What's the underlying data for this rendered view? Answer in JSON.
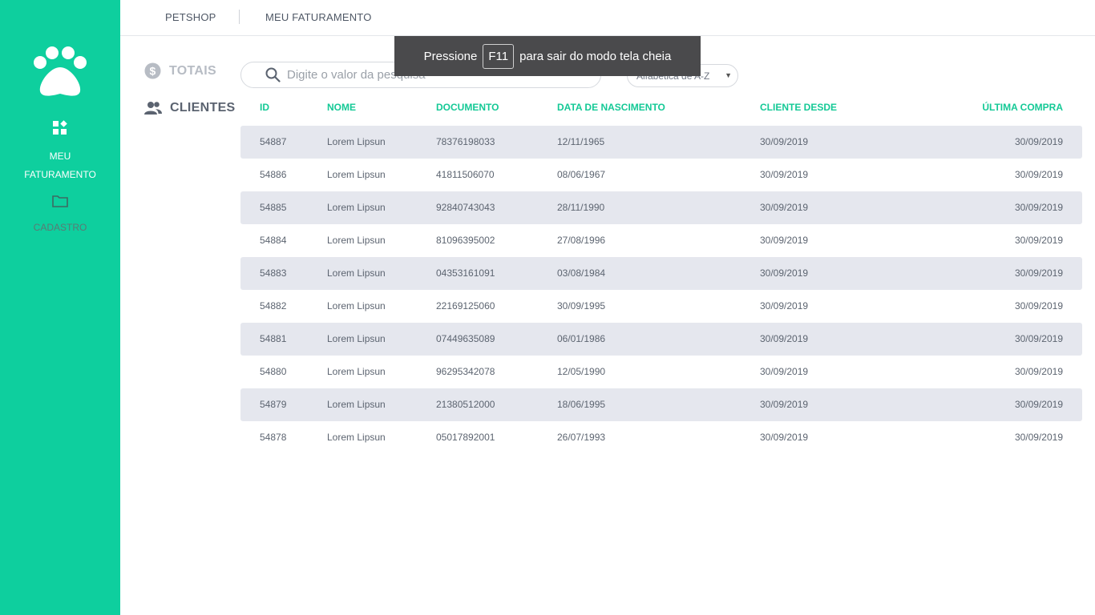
{
  "sidebar": {
    "items": [
      {
        "label_line1": "MEU",
        "label_line2": "FATURAMENTO",
        "icon": "dashboard-icon"
      },
      {
        "label": "CADASTRO",
        "icon": "folder-icon"
      }
    ],
    "logo_icon": "paw-icon",
    "color": "#0ecf9e"
  },
  "topnav": {
    "petshop": "PETSHOP",
    "faturamento": "MEU FATURAMENTO"
  },
  "submenu": {
    "totais": "TOTAIS",
    "clientes": "CLIENTES"
  },
  "search": {
    "placeholder": "Digite o valor da pesquisa"
  },
  "sort": {
    "selected": "Alfabetica de A-Z"
  },
  "toast": {
    "before": "Pressione",
    "key": "F11",
    "after": "para sair do modo tela cheia"
  },
  "table": {
    "headers": {
      "id": "ID",
      "nome": "NOME",
      "documento": "DOCUMENTO",
      "nascimento": "DATA DE NASCIMENTO",
      "desde": "CLIENTE DESDE",
      "ultima": "ÚLTIMA COMPRA"
    },
    "rows": [
      {
        "id": "54887",
        "nome": "Lorem Lipsun",
        "documento": "78376198033",
        "nascimento": "12/11/1965",
        "desde": "30/09/2019",
        "ultima": "30/09/2019"
      },
      {
        "id": "54886",
        "nome": "Lorem Lipsun",
        "documento": "41811506070",
        "nascimento": "08/06/1967",
        "desde": "30/09/2019",
        "ultima": "30/09/2019"
      },
      {
        "id": "54885",
        "nome": "Lorem Lipsun",
        "documento": "92840743043",
        "nascimento": "28/11/1990",
        "desde": "30/09/2019",
        "ultima": "30/09/2019"
      },
      {
        "id": "54884",
        "nome": "Lorem Lipsun",
        "documento": "81096395002",
        "nascimento": "27/08/1996",
        "desde": "30/09/2019",
        "ultima": "30/09/2019"
      },
      {
        "id": "54883",
        "nome": "Lorem Lipsun",
        "documento": "04353161091",
        "nascimento": "03/08/1984",
        "desde": "30/09/2019",
        "ultima": "30/09/2019"
      },
      {
        "id": "54882",
        "nome": "Lorem Lipsun",
        "documento": "22169125060",
        "nascimento": "30/09/1995",
        "desde": "30/09/2019",
        "ultima": "30/09/2019"
      },
      {
        "id": "54881",
        "nome": "Lorem Lipsun",
        "documento": "07449635089",
        "nascimento": "06/01/1986",
        "desde": "30/09/2019",
        "ultima": "30/09/2019"
      },
      {
        "id": "54880",
        "nome": "Lorem Lipsun",
        "documento": "96295342078",
        "nascimento": "12/05/1990",
        "desde": "30/09/2019",
        "ultima": "30/09/2019"
      },
      {
        "id": "54879",
        "nome": "Lorem Lipsun",
        "documento": "21380512000",
        "nascimento": "18/06/1995",
        "desde": "30/09/2019",
        "ultima": "30/09/2019"
      },
      {
        "id": "54878",
        "nome": "Lorem Lipsun",
        "documento": "05017892001",
        "nascimento": "26/07/1993",
        "desde": "30/09/2019",
        "ultima": "30/09/2019"
      }
    ]
  }
}
